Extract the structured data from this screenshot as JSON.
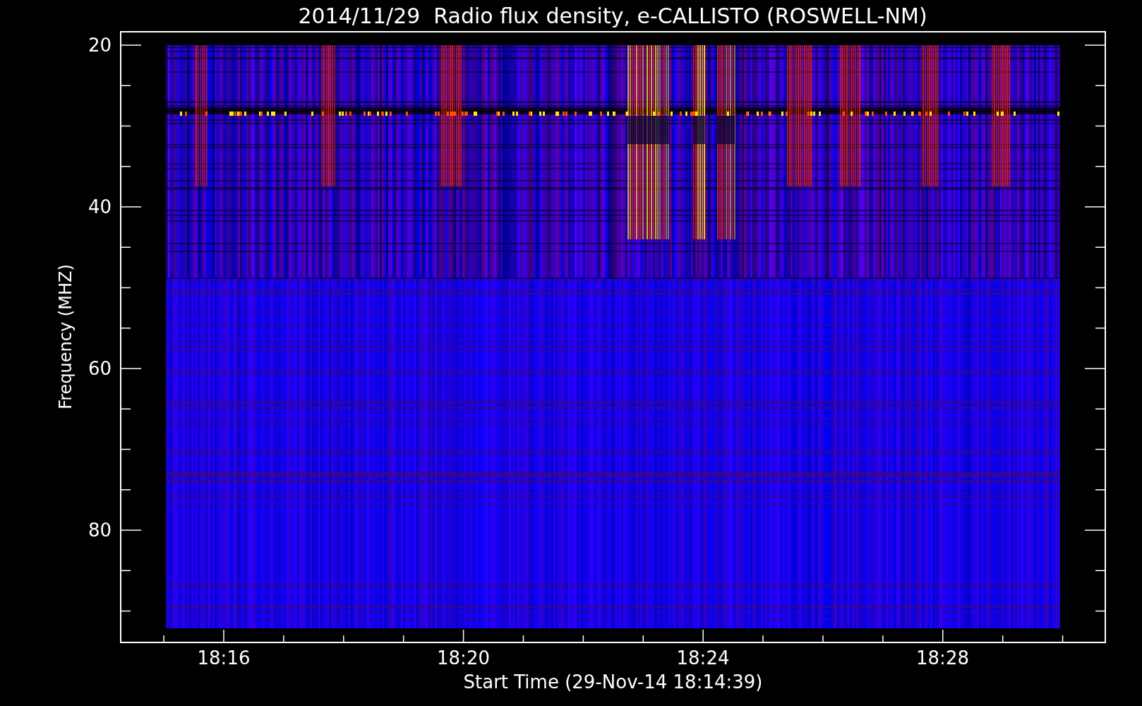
{
  "title": "2014/11/29  Radio flux density, e-CALLISTO (ROSWELL-NM)",
  "y_axis": {
    "label": "Frequency (MHZ)",
    "ticks": [
      "20",
      "40",
      "60",
      "80"
    ]
  },
  "x_axis": {
    "label": "Start Time (29-Nov-14 18:14:39)",
    "ticks": [
      "18:16",
      "18:20",
      "18:24",
      "18:28"
    ]
  }
}
